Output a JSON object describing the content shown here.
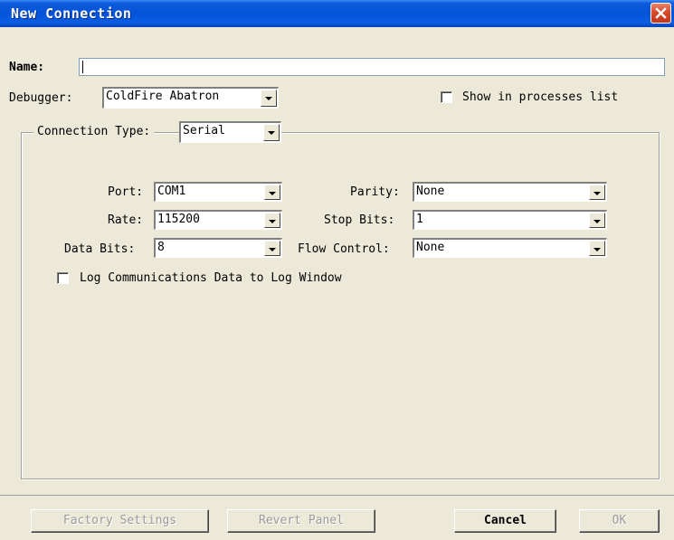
{
  "window": {
    "title": "New Connection"
  },
  "name_field": {
    "label": "Name:",
    "value": ""
  },
  "debugger": {
    "label": "Debugger:",
    "value": "ColdFire Abatron"
  },
  "show_in_processes": {
    "label": "Show in processes list",
    "checked": false
  },
  "connection_type": {
    "label": "Connection Type:",
    "value": "Serial"
  },
  "serial": {
    "port": {
      "label": "Port:",
      "value": "COM1"
    },
    "rate": {
      "label": "Rate:",
      "value": "115200"
    },
    "data_bits": {
      "label": "Data Bits:",
      "value": "8"
    },
    "parity": {
      "label": "Parity:",
      "value": "None"
    },
    "stop_bits": {
      "label": "Stop Bits:",
      "value": "1"
    },
    "flow_control": {
      "label": "Flow Control:",
      "value": "None"
    }
  },
  "log_comm": {
    "label": "Log Communications Data to Log Window",
    "checked": false
  },
  "buttons": {
    "factory": "Factory Settings",
    "revert": "Revert Panel",
    "cancel": "Cancel",
    "ok": "OK"
  },
  "colors": {
    "titlebar": "#0553d8",
    "dialog_bg": "#ece9d8",
    "close_button": "#d8492a"
  }
}
